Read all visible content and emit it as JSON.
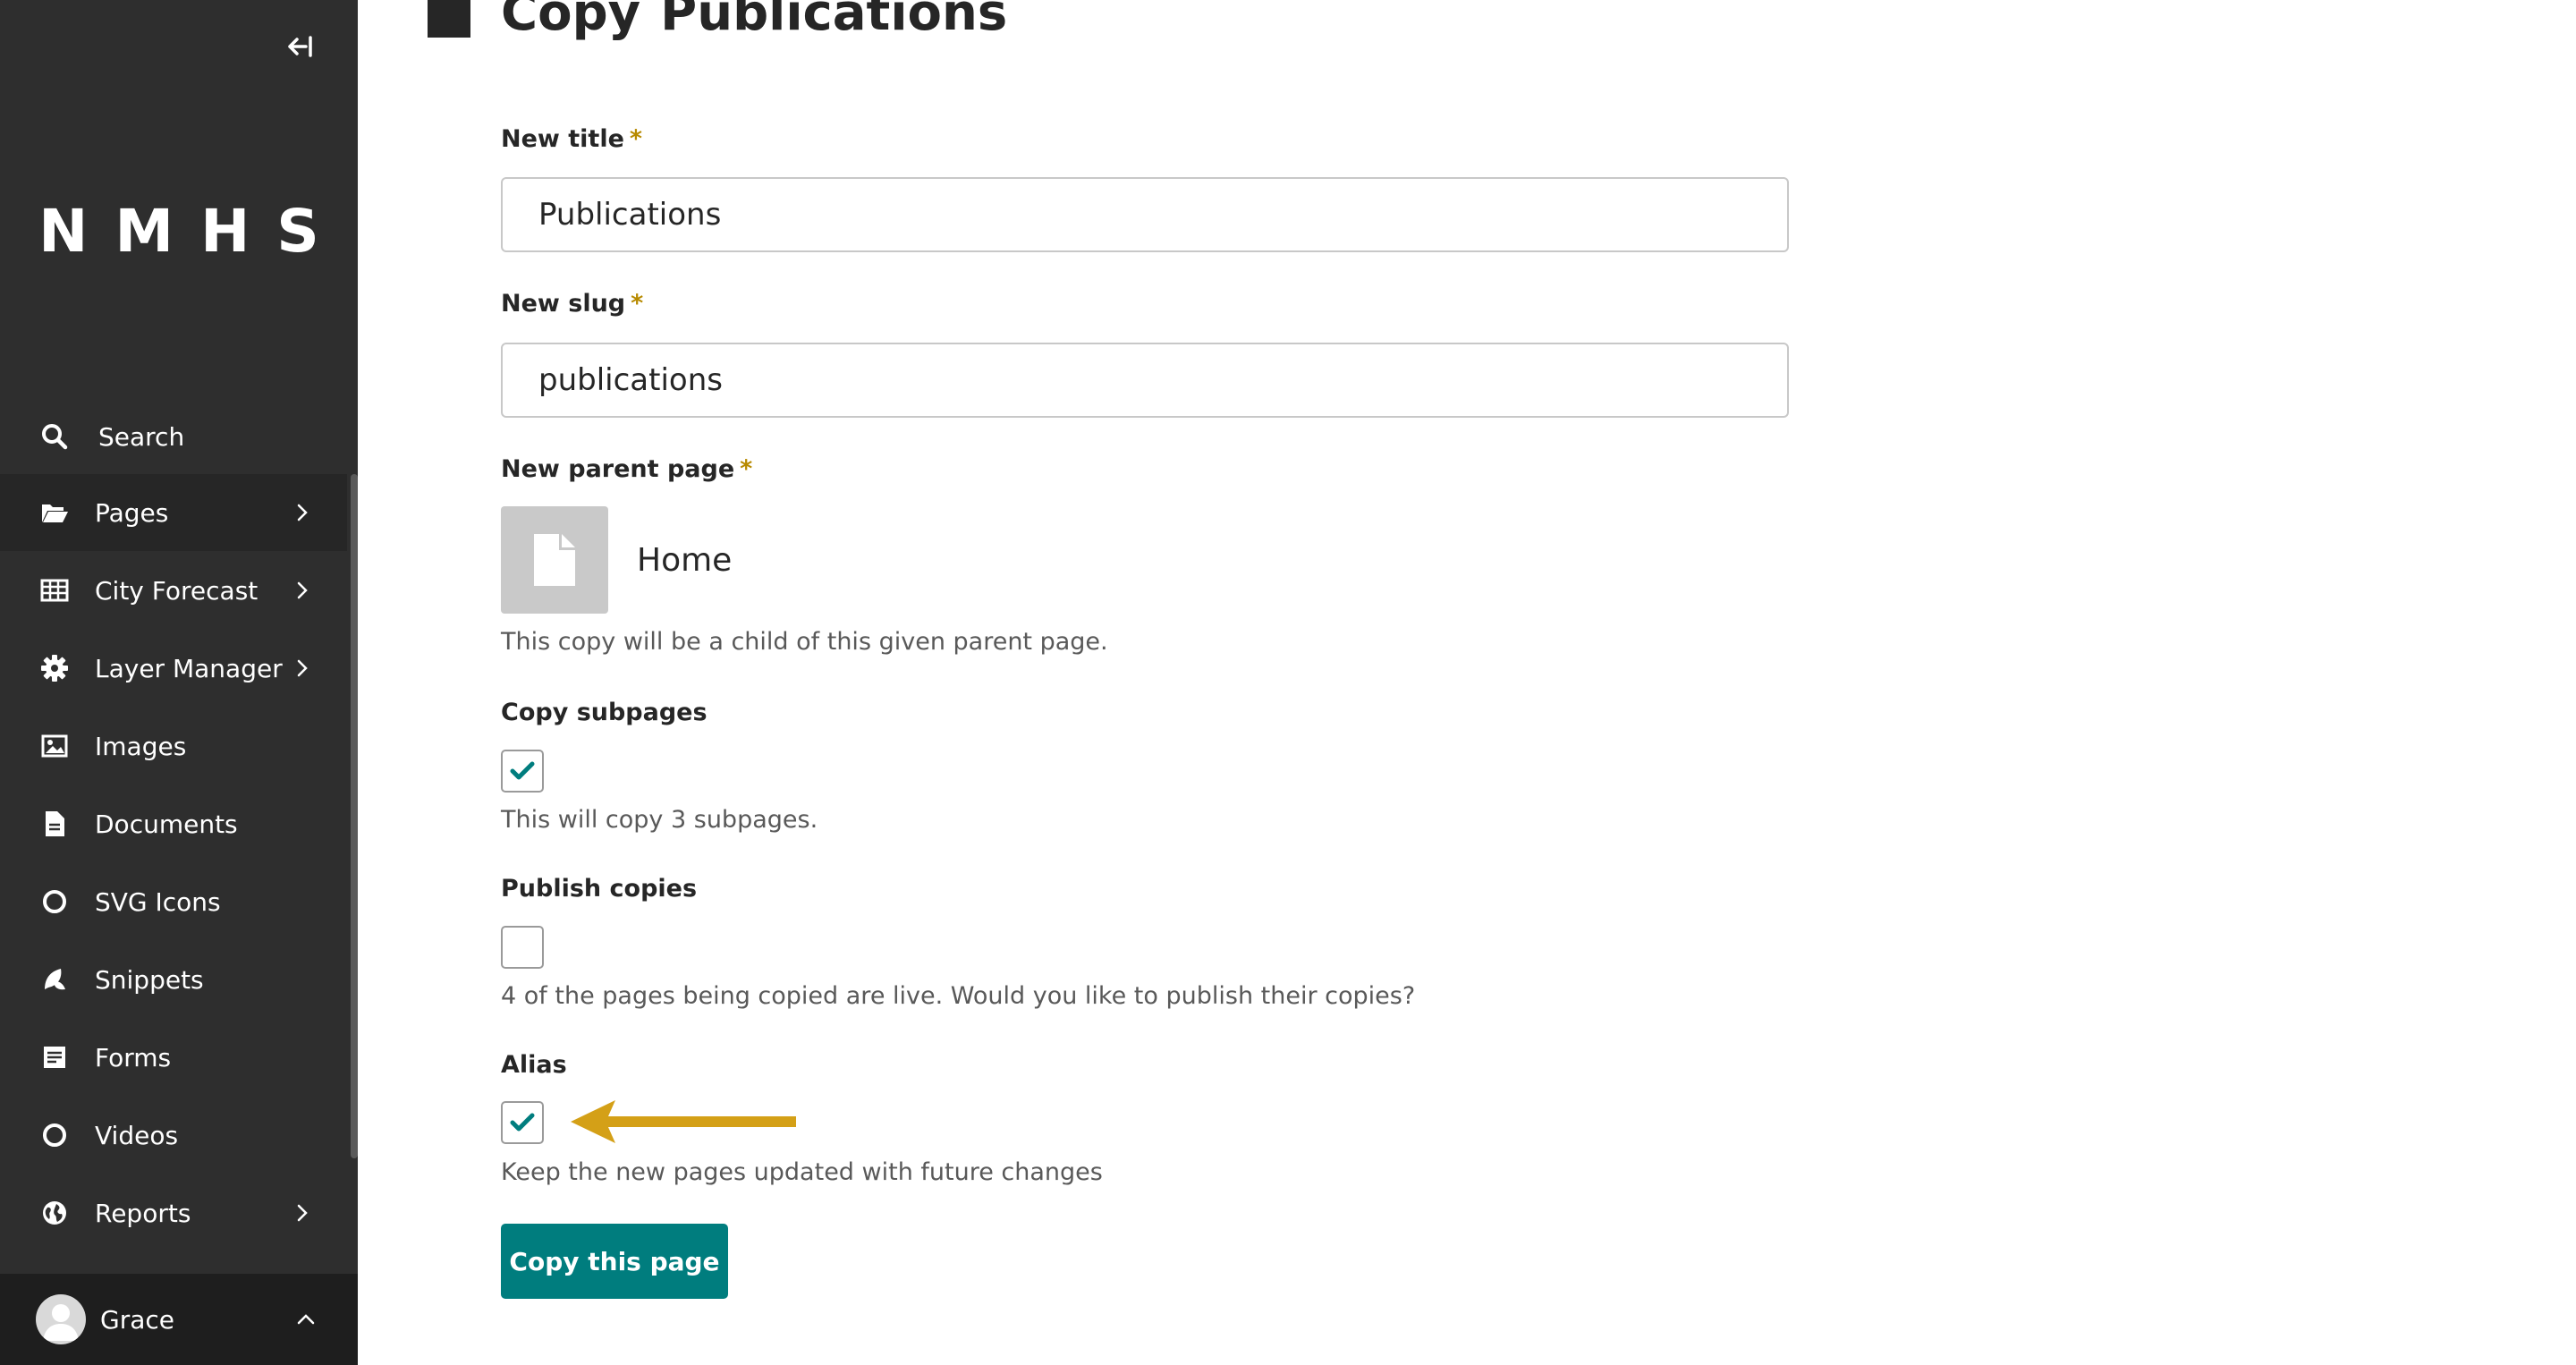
{
  "sidebar": {
    "logo": "NMHS",
    "nav": [
      {
        "label": "Search",
        "icon": "search-icon",
        "has_chevron": false
      },
      {
        "label": "Pages",
        "icon": "folder-open-icon",
        "has_chevron": true
      },
      {
        "label": "City Forecast",
        "icon": "table-icon",
        "has_chevron": true
      },
      {
        "label": "Layer Manager",
        "icon": "gear-icon",
        "has_chevron": true
      },
      {
        "label": "Images",
        "icon": "image-icon",
        "has_chevron": false
      },
      {
        "label": "Documents",
        "icon": "document-icon",
        "has_chevron": false
      },
      {
        "label": "SVG Icons",
        "icon": "circle-icon",
        "has_chevron": false
      },
      {
        "label": "Snippets",
        "icon": "snippet-icon",
        "has_chevron": false
      },
      {
        "label": "Forms",
        "icon": "form-icon",
        "has_chevron": false
      },
      {
        "label": "Videos",
        "icon": "circle-icon",
        "has_chevron": false
      },
      {
        "label": "Reports",
        "icon": "globe-icon",
        "has_chevron": true
      }
    ],
    "account": {
      "name": "Grace"
    }
  },
  "header": {
    "action": "Copy",
    "page_name": "Publications"
  },
  "form": {
    "title": {
      "label": "New title",
      "required": "*",
      "value": "Publications"
    },
    "slug": {
      "label": "New slug",
      "required": "*",
      "value": "publications"
    },
    "parent": {
      "label": "New parent page",
      "required": "*",
      "value": "Home",
      "help": "This copy will be a child of this given parent page."
    },
    "copy_subpages": {
      "label": "Copy subpages",
      "checked": true,
      "help": "This will copy 3 subpages."
    },
    "publish_copies": {
      "label": "Publish copies",
      "checked": false,
      "help": "4 of the pages being copied are live. Would you like to publish their copies?"
    },
    "alias": {
      "label": "Alias",
      "checked": true,
      "help": "Keep the new pages updated with future changes"
    },
    "submit_label": "Copy this page"
  },
  "colors": {
    "sidebar_bg": "#2e2e2e",
    "accent": "#007d7e",
    "required": "#b78a00",
    "annotation_arrow": "#d4a017"
  }
}
